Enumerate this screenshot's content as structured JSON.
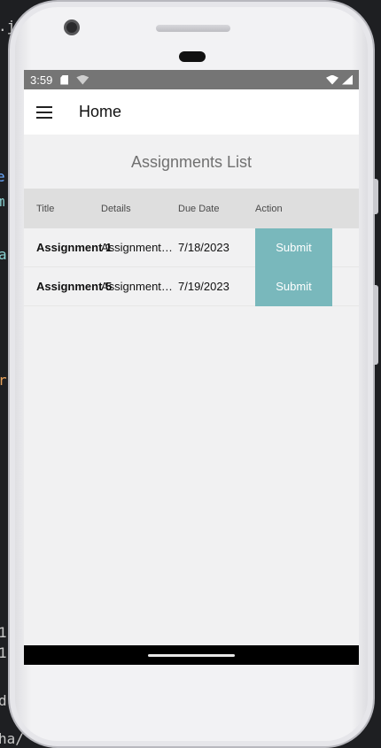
{
  "status_bar": {
    "time": "3:59",
    "icons": [
      "sd-card-icon",
      "wifi-off-icon",
      "wifi-icon",
      "signal-icon"
    ]
  },
  "app_bar": {
    "title": "Home",
    "menu_icon": "hamburger-menu-icon"
  },
  "main": {
    "heading": "Assignments List",
    "columns": [
      "Title",
      "Details",
      "Due Date",
      "Action"
    ],
    "rows": [
      {
        "title": "Assignment 1",
        "details": "Assignment…",
        "due_date": "7/18/2023",
        "action": "Submit"
      },
      {
        "title": "Assignment 5",
        "details": "Assignment…",
        "due_date": "7/19/2023",
        "action": "Submit"
      }
    ]
  },
  "colors": {
    "status_bar": "#757575",
    "header_row": "#dedede",
    "submit_button": "#79b8bc",
    "screen_background": "#f1f1f2"
  }
}
